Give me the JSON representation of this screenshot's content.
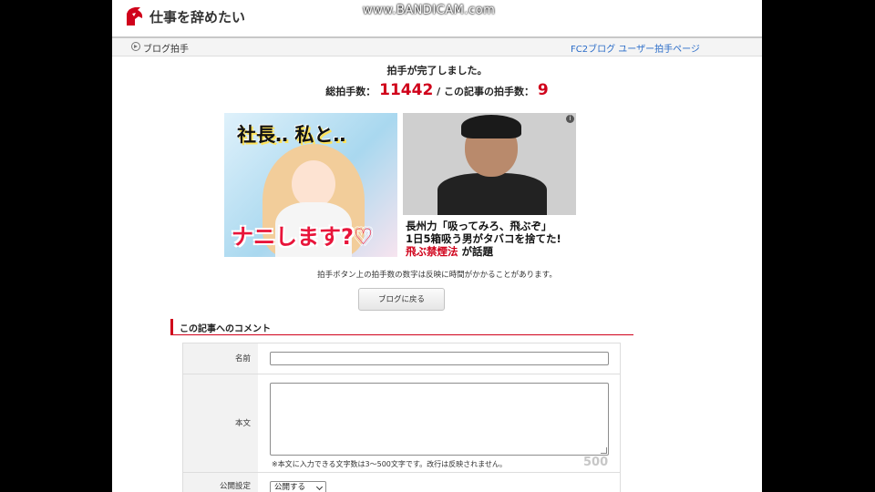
{
  "watermark": "www.BANDICAM.com",
  "header": {
    "site_title": "仕事を辞めたい",
    "breadcrumb": "ブログ拍手",
    "fc2_link": "FC2ブログ ユーザー拍手ページ"
  },
  "clap": {
    "complete_message": "拍手が完了しました。",
    "total_label": "総拍手数：",
    "total_value": "11442",
    "separator": " / ",
    "article_label": "この記事の拍手数：",
    "article_value": "9"
  },
  "ads": {
    "ad1_line1": "社長‥ 私と‥",
    "ad1_line2": "ナニします?♡",
    "ad2_info": "i",
    "ad2_line1": "長州力「吸ってみろ、飛ぶぞ」",
    "ad2_line2": "1日5箱吸う男がタバコを捨てた!",
    "ad2_line3_red": "飛ぶ禁煙法",
    "ad2_line3_rest": "が話題"
  },
  "note": "拍手ボタン上の拍手数の数字は反映に時間がかかることがあります。",
  "back_button": "ブログに戻る",
  "comments": {
    "heading": "この記事へのコメント",
    "name_label": "名前",
    "body_label": "本文",
    "body_hint": "※本文に入力できる文字数は3～500文字です。改行は反映されません。",
    "char_counter": "500",
    "visibility_label": "公開設定",
    "visibility_selected": "公開する"
  },
  "colors": {
    "accent_red": "#d0021b",
    "link_blue": "#2a6cc8"
  }
}
